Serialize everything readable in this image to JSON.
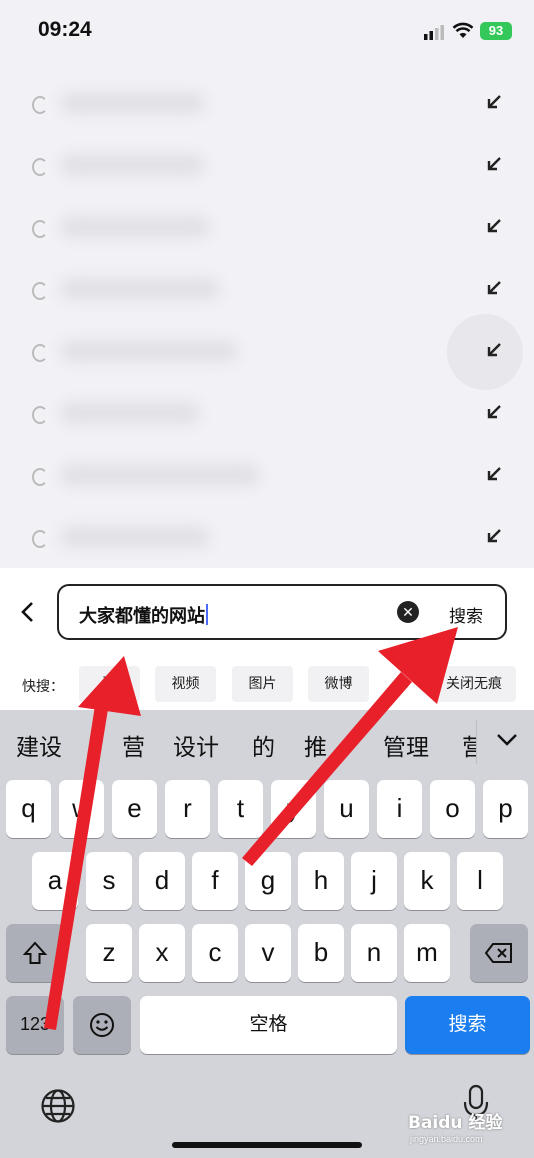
{
  "status": {
    "time": "09:24",
    "battery": "93"
  },
  "suggestions": {
    "count": 8
  },
  "search": {
    "value": "大家都懂的网站",
    "button": "搜索"
  },
  "quick": {
    "label": "快搜：",
    "chips": [
      "百",
      "视频",
      "图片",
      "微博",
      "关闭无痕"
    ]
  },
  "candidates": [
    "建设",
    "营",
    "设计",
    "的",
    "推",
    "管理",
    "营"
  ],
  "keyboard": {
    "row1": [
      "q",
      "w",
      "e",
      "r",
      "t",
      "y",
      "u",
      "i",
      "o",
      "p"
    ],
    "row2": [
      "a",
      "s",
      "d",
      "f",
      "g",
      "h",
      "j",
      "k",
      "l"
    ],
    "row3": [
      "z",
      "x",
      "c",
      "v",
      "b",
      "n",
      "m"
    ],
    "numbers": "123",
    "space": "空格",
    "search": "搜索"
  },
  "watermark": {
    "brand": "Baidu 经验",
    "url": "jingyan.baidu.com"
  },
  "colors": {
    "accent": "#1a7df0",
    "arrow": "#e8202a"
  }
}
